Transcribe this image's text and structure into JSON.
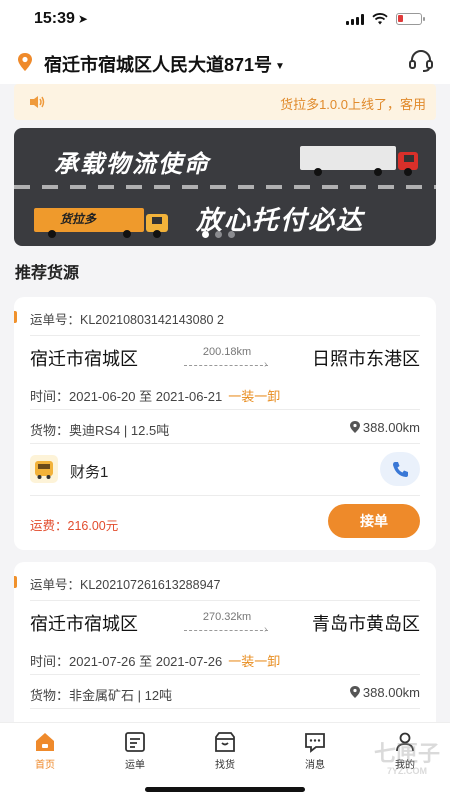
{
  "status_bar": {
    "time": "15:39"
  },
  "header": {
    "location": "宿迁市宿城区人民大道871号"
  },
  "notice": {
    "text": "货拉多1.0.0上线了，客用"
  },
  "banner": {
    "slogan_top": "承载物流使命",
    "slogan_bottom": "放心托付必达",
    "truck_brand": "货拉多",
    "slide_count": 3,
    "active_slide": 0
  },
  "section": {
    "title": "推荐货源"
  },
  "cards": [
    {
      "waybill": "运单号：KL20210803142143080 2",
      "from": "宿迁市宿城区",
      "to": "日照市东港区",
      "distance": "200.18km",
      "time": "时间：2021-06-20 至 2021-06-21",
      "mode": "一装一卸",
      "goods": "货物：奥迪RS4 | 12.5吨",
      "route_distance": "388.00km",
      "owner": "财务1",
      "fee": "运费：216.00元",
      "action": "接单"
    },
    {
      "waybill": "运单号：KL202107261613288947",
      "from": "宿迁市宿城区",
      "to": "青岛市黄岛区",
      "distance": "270.32km",
      "time": "时间：2021-07-26 至 2021-07-26",
      "mode": "一装一卸",
      "goods": "货物：非金属矿石 | 12吨",
      "route_distance": "388.00km"
    }
  ],
  "tabbar": {
    "items": [
      {
        "label": "首页",
        "icon": "home-icon",
        "active": true
      },
      {
        "label": "运单",
        "icon": "waybill-icon"
      },
      {
        "label": "找货",
        "icon": "box-icon"
      },
      {
        "label": "消息",
        "icon": "message-icon"
      },
      {
        "label": "我的",
        "icon": "profile-icon"
      }
    ]
  },
  "watermark": {
    "text": "七匣子",
    "sub": "7YZ.COM"
  },
  "colors": {
    "accent": "#ee8a2a",
    "fee": "#e24d2e",
    "notice_bg": "#fdf3e2"
  }
}
